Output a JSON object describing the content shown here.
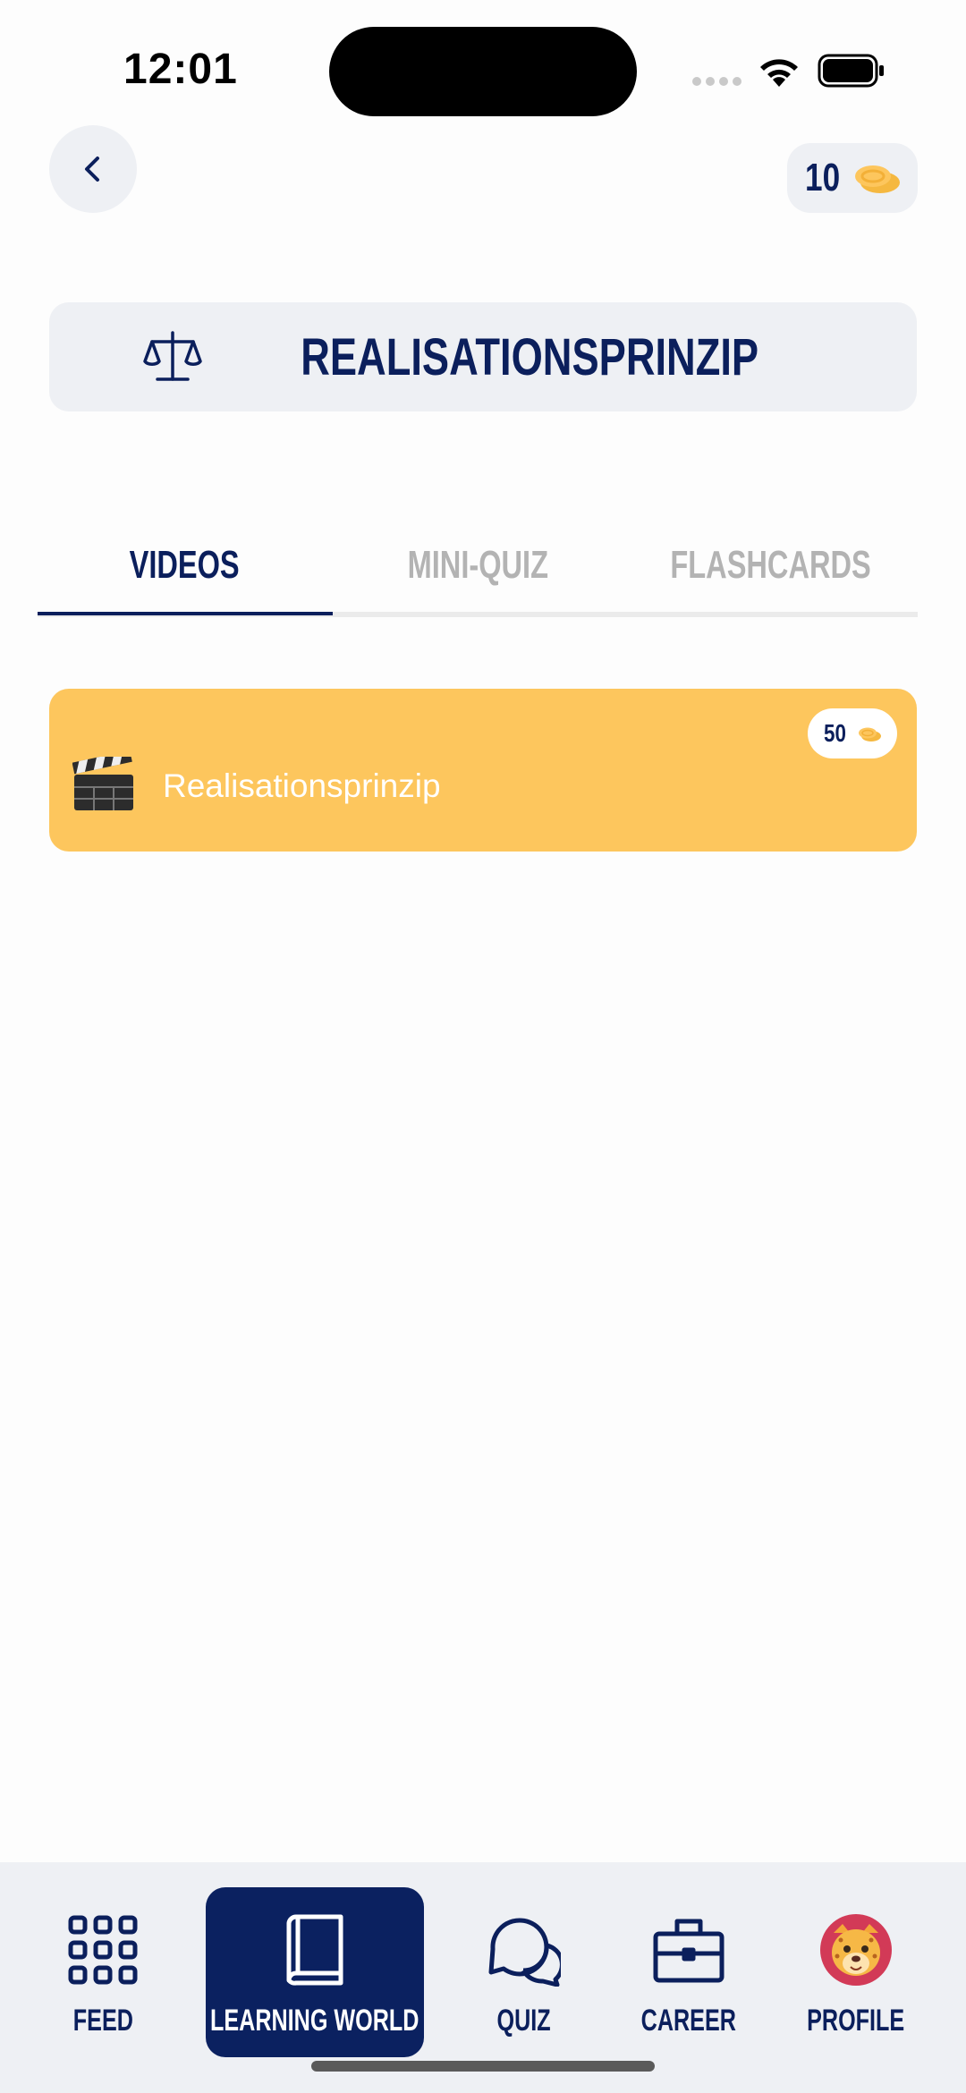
{
  "status_bar": {
    "time": "12:01"
  },
  "header": {
    "coins": "10"
  },
  "topic": {
    "title": "REALISATIONSPRINZIP",
    "icon": "scale-icon"
  },
  "tabs": [
    {
      "label": "VIDEOS",
      "active": true
    },
    {
      "label": "MINI-QUIZ",
      "active": false
    },
    {
      "label": "FLASHCARDS",
      "active": false
    }
  ],
  "videos": [
    {
      "title": "Realisationsprinzip",
      "reward": "50",
      "icon": "clapperboard-icon"
    }
  ],
  "bottom_nav": [
    {
      "label": "FEED",
      "icon": "grid-icon",
      "active": false
    },
    {
      "label": "LEARNING WORLD",
      "icon": "book-icon",
      "active": true
    },
    {
      "label": "QUIZ",
      "icon": "chat-bubbles-icon",
      "active": false
    },
    {
      "label": "CAREER",
      "icon": "briefcase-icon",
      "active": false
    },
    {
      "label": "PROFILE",
      "icon": "avatar-icon",
      "active": false
    }
  ],
  "colors": {
    "primary": "#0b1f5c",
    "accent": "#fdc65d",
    "surface": "#eef0f4"
  }
}
